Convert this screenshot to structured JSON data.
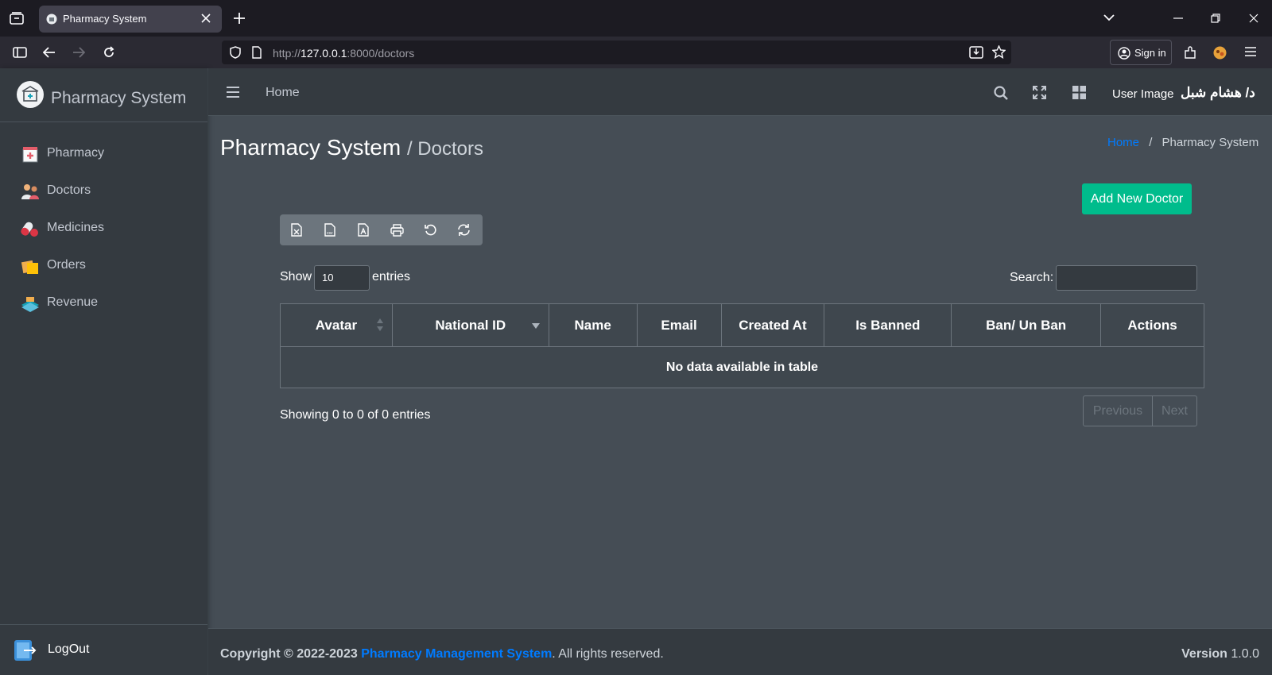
{
  "browser": {
    "tab_title": "Pharmacy System",
    "url_prefix": "http://",
    "url_host": "127.0.0.1",
    "url_rest": ":8000/doctors",
    "sign_in": "Sign in"
  },
  "sidebar": {
    "brand": "Pharmacy System",
    "items": [
      {
        "label": "Pharmacy",
        "icon": "pharmacy-icon"
      },
      {
        "label": "Doctors",
        "icon": "doctors-icon"
      },
      {
        "label": "Medicines",
        "icon": "medicines-icon"
      },
      {
        "label": "Orders",
        "icon": "orders-icon"
      },
      {
        "label": "Revenue",
        "icon": "revenue-icon"
      }
    ],
    "logout": "LogOut"
  },
  "header": {
    "home": "Home",
    "user_image_alt": "User Image",
    "user_name": "د/ هشام شبل"
  },
  "content": {
    "title": "Pharmacy System",
    "subtitle": "/ Doctors",
    "breadcrumb_home": "Home",
    "breadcrumb_sep": "/",
    "breadcrumb_current": "Pharmacy System",
    "add_button": "Add New Doctor",
    "toolbar_buttons": [
      "excel-export",
      "csv-export",
      "pdf-export",
      "print",
      "reset",
      "reload"
    ],
    "show_label": "Show",
    "entries_value": "10",
    "entries_label": "entries",
    "search_label": "Search:",
    "search_value": "",
    "table": {
      "columns": [
        "Avatar",
        "National ID",
        "Name",
        "Email",
        "Created At",
        "Is Banned",
        "Ban/ Un Ban",
        "Actions"
      ],
      "empty_message": "No data available in table"
    },
    "info": "Showing 0 to 0 of 0 entries",
    "pager_prev": "Previous",
    "pager_next": "Next"
  },
  "footer": {
    "copyright_prefix": "Copyright © 2022-2023 ",
    "company": "Pharmacy Management System",
    "copyright_suffix": ". All rights reserved.",
    "version_label": "Version",
    "version_value": "1.0.0"
  },
  "colors": {
    "sidebar_bg": "#343a40",
    "content_bg": "#454d55",
    "accent_green": "#00bc8c",
    "link_blue": "#007bff"
  }
}
